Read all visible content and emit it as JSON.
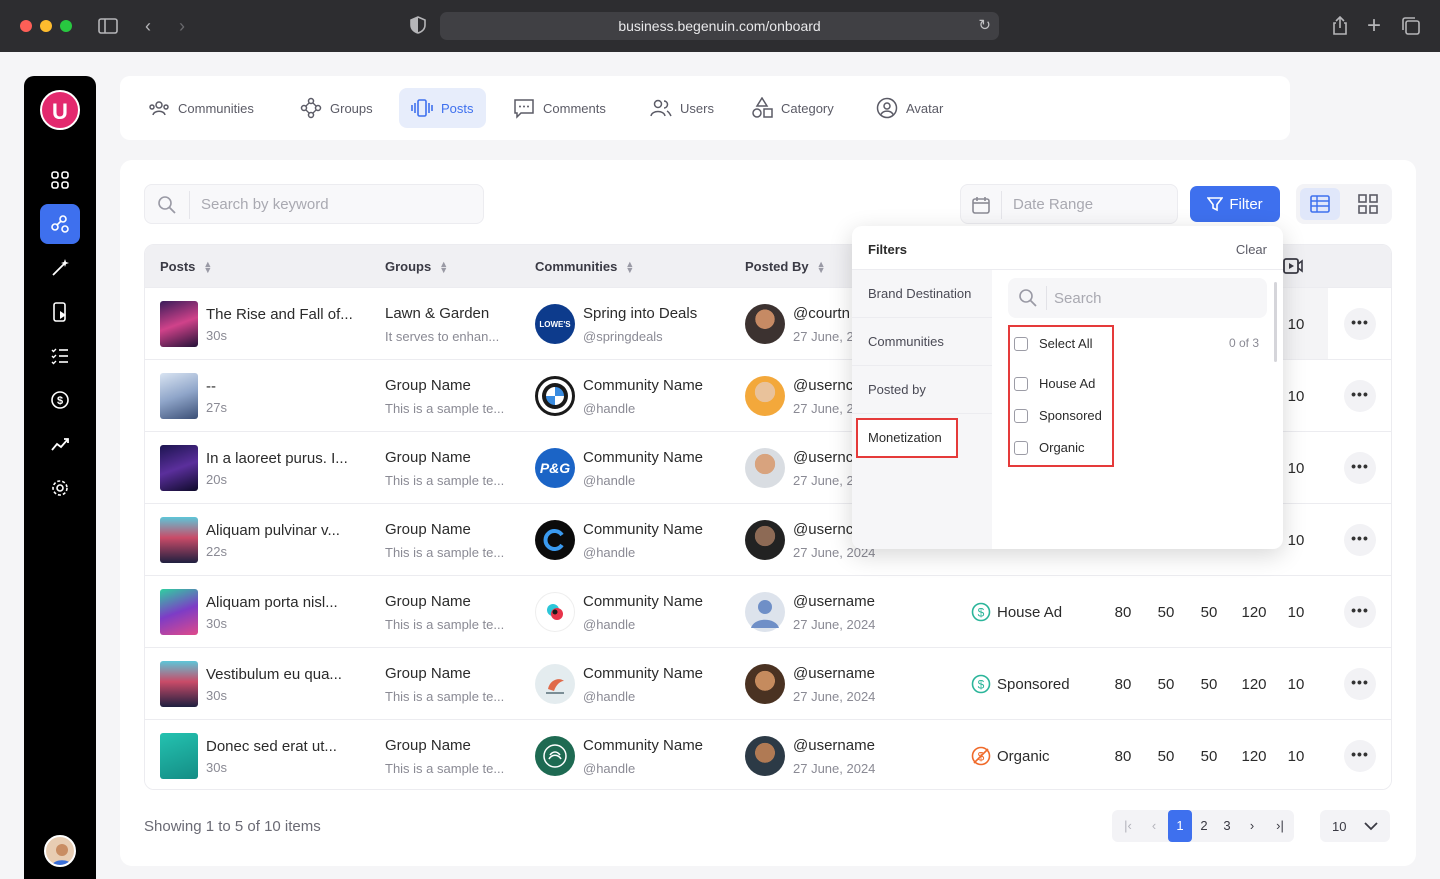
{
  "browser": {
    "url": "business.begenuin.com/onboard"
  },
  "tabs": [
    {
      "label": "Communities",
      "icon": "communities-icon"
    },
    {
      "label": "Groups",
      "icon": "groups-icon"
    },
    {
      "label": "Posts",
      "icon": "posts-icon"
    },
    {
      "label": "Comments",
      "icon": "comments-icon"
    },
    {
      "label": "Users",
      "icon": "users-icon"
    },
    {
      "label": "Category",
      "icon": "category-icon"
    },
    {
      "label": "Avatar",
      "icon": "avatar-icon"
    }
  ],
  "toolbar": {
    "search_placeholder": "Search by keyword",
    "date_range": "Date Range",
    "filter_label": "Filter"
  },
  "table": {
    "headers": {
      "posts": "Posts",
      "groups": "Groups",
      "communities": "Communities",
      "posted_by": "Posted By"
    },
    "rows": [
      {
        "title": "The Rise and Fall of...",
        "duration": "30s",
        "group": "Lawn & Garden",
        "group_desc": "It serves to enhan...",
        "community": "Spring into Deals",
        "handle": "@springdeals",
        "user": "@courtn",
        "date": "27 June, 2",
        "monetization": "",
        "metrics": [
          "",
          "",
          "",
          "",
          "10"
        ]
      },
      {
        "title": "--",
        "duration": "27s",
        "group": "Group Name",
        "group_desc": "This is a sample te...",
        "community": "Community Name",
        "handle": "@handle",
        "user": "@usernc",
        "date": "27 June, 2",
        "monetization": "",
        "metrics": [
          "",
          "",
          "",
          "",
          "10"
        ]
      },
      {
        "title": "In a laoreet purus. I...",
        "duration": "20s",
        "group": "Group Name",
        "group_desc": "This is a sample te...",
        "community": "Community Name",
        "handle": "@handle",
        "user": "@usernc",
        "date": "27 June, 2",
        "monetization": "",
        "metrics": [
          "",
          "",
          "",
          "",
          "10"
        ]
      },
      {
        "title": "Aliquam pulvinar v...",
        "duration": "22s",
        "group": "Group Name",
        "group_desc": "This is a sample te...",
        "community": "Community Name",
        "handle": "@handle",
        "user": "@usernc",
        "date": "27 June, 2024",
        "monetization": "",
        "metrics": [
          "",
          "",
          "",
          "",
          "10"
        ]
      },
      {
        "title": "Aliquam porta nisl...",
        "duration": "30s",
        "group": "Group Name",
        "group_desc": "This is a sample te...",
        "community": "Community Name",
        "handle": "@handle",
        "user": "@username",
        "date": "27 June, 2024",
        "monetization": "House Ad",
        "metrics": [
          "80",
          "50",
          "50",
          "120",
          "10"
        ]
      },
      {
        "title": "Vestibulum eu qua...",
        "duration": "30s",
        "group": "Group Name",
        "group_desc": "This is a sample te...",
        "community": "Community Name",
        "handle": "@handle",
        "user": "@username",
        "date": "27 June, 2024",
        "monetization": "Sponsored",
        "metrics": [
          "80",
          "50",
          "50",
          "120",
          "10"
        ]
      },
      {
        "title": "Donec sed erat ut...",
        "duration": "30s",
        "group": "Group Name",
        "group_desc": "This is a sample te...",
        "community": "Community Name",
        "handle": "@handle",
        "user": "@username",
        "date": "27 June, 2024",
        "monetization": "Organic",
        "metrics": [
          "80",
          "50",
          "50",
          "120",
          "10"
        ]
      }
    ]
  },
  "footer": {
    "showing": "Showing 1 to 5 of 10 items",
    "pages": [
      "1",
      "2",
      "3"
    ],
    "per_page": "10"
  },
  "filters": {
    "title": "Filters",
    "clear": "Clear",
    "categories": [
      "Brand Destination",
      "Communities",
      "Posted by",
      "Monetization"
    ],
    "search_placeholder": "Search",
    "select_all": "Select All",
    "count": "0 of 3",
    "options": [
      "House Ad",
      "Sponsored",
      "Organic"
    ]
  },
  "colors": {
    "accent": "#3e70ee",
    "highlight": "#e53a3a",
    "monetization_green": "#2bb59a",
    "organic_orange": "#f06a2a"
  }
}
